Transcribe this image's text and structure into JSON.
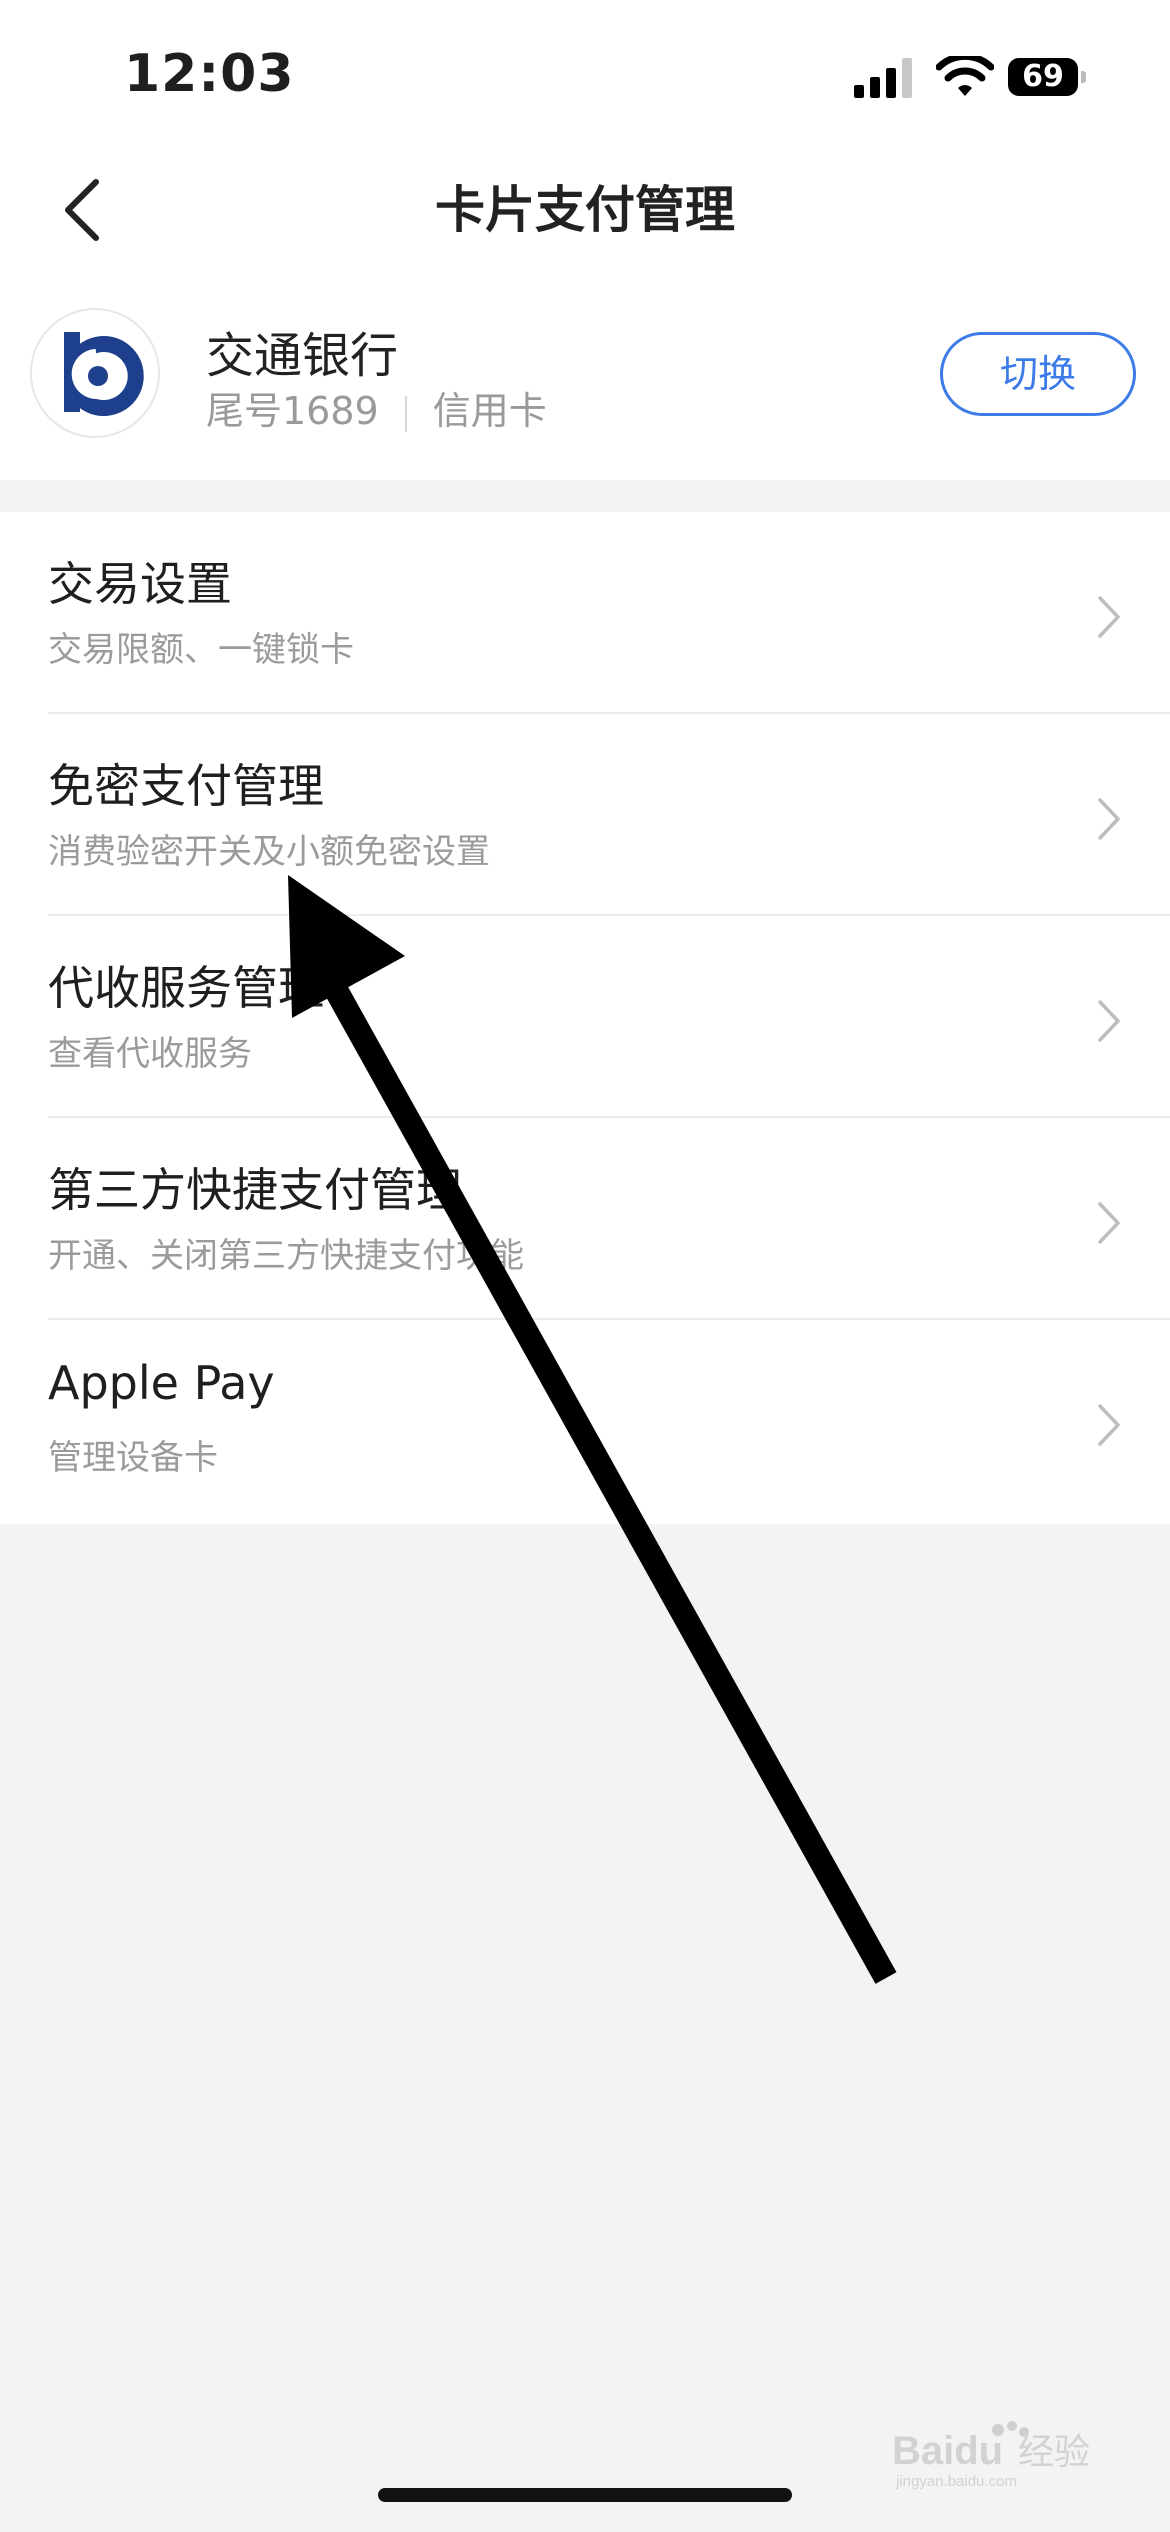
{
  "status_bar": {
    "time": "12:03",
    "battery_level": "69",
    "icons": [
      "cellular-signal-icon",
      "wifi-icon",
      "battery-icon"
    ]
  },
  "nav": {
    "title": "卡片支付管理",
    "back_icon": "chevron-left-icon"
  },
  "card": {
    "bank_name": "交通银行",
    "card_tail": "尾号1689",
    "card_type": "信用卡",
    "switch_label": "切换",
    "logo": "bank-of-communications-logo",
    "accent_color": "#3d7be8",
    "logo_color": "#1d3f8c"
  },
  "menu": {
    "items": [
      {
        "title": "交易设置",
        "subtitle": "交易限额、一键锁卡"
      },
      {
        "title": "免密支付管理",
        "subtitle": "消费验密开关及小额免密设置"
      },
      {
        "title": "代收服务管理",
        "subtitle": "查看代收服务"
      },
      {
        "title": "第三方快捷支付管理",
        "subtitle": "开通、关闭第三方快捷支付功能"
      },
      {
        "title": "Apple Pay",
        "subtitle": "管理设备卡"
      }
    ]
  },
  "watermark": {
    "brand": "Baidu",
    "suffix": "经验",
    "url": "jingyan.baidu.com"
  }
}
